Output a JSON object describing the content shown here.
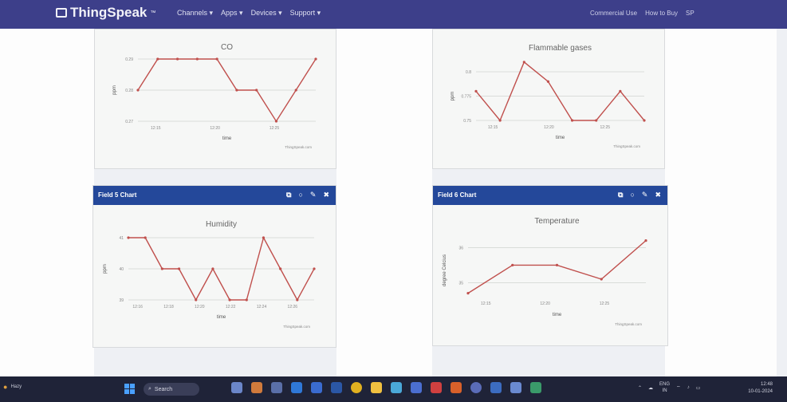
{
  "nav": {
    "brand": "ThingSpeak",
    "brand_mark": "™",
    "links": [
      "Channels ▾",
      "Apps ▾",
      "Devices ▾",
      "Support ▾"
    ],
    "right_links": [
      "Commercial Use",
      "How to Buy",
      "SP"
    ]
  },
  "panels": {
    "field5_header": "Field 5 Chart",
    "field6_header": "Field 6 Chart",
    "header_icons": [
      "external-link-icon",
      "comment-icon",
      "pencil-icon",
      "close-icon"
    ]
  },
  "chart_data": [
    {
      "type": "line",
      "title": "CO",
      "xlabel": "time",
      "ylabel": "ppm",
      "credit": "ThingSpeak.com",
      "x_ticks": [
        "12:15",
        "12:20",
        "12:25"
      ],
      "y_ticks": [
        0.27,
        0.28,
        0.29
      ],
      "ylim": [
        0.27,
        0.29
      ],
      "x": [
        0,
        1,
        2,
        3,
        4,
        5,
        6,
        7,
        8,
        9
      ],
      "values": [
        0.28,
        0.29,
        0.29,
        0.29,
        0.29,
        0.28,
        0.28,
        0.27,
        0.28,
        0.29
      ],
      "color": "#c0504d"
    },
    {
      "type": "line",
      "title": "Flammable gases",
      "xlabel": "time",
      "ylabel": "ppm",
      "credit": "ThingSpeak.com",
      "x_ticks": [
        "12:15",
        "12:20",
        "12:25"
      ],
      "y_ticks": [
        0.75,
        0.775,
        0.8
      ],
      "ylim": [
        0.75,
        0.8
      ],
      "x": [
        0,
        1,
        2,
        3,
        4,
        5,
        6,
        7,
        8,
        9
      ],
      "values": [
        0.78,
        0.75,
        0.81,
        0.79,
        0.75,
        0.75,
        0.78,
        0.75
      ],
      "color": "#c0504d"
    },
    {
      "type": "line",
      "title": "Humidity",
      "xlabel": "time",
      "ylabel": "ppm",
      "credit": "ThingSpeak.com",
      "x_ticks": [
        "12:16",
        "12:18",
        "12:20",
        "12:22",
        "12:24",
        "12:26"
      ],
      "y_ticks": [
        39,
        40,
        41
      ],
      "ylim": [
        39,
        41
      ],
      "values": [
        41,
        41,
        40,
        40,
        39,
        40,
        39,
        39,
        41,
        40,
        39,
        40
      ],
      "color": "#c0504d"
    },
    {
      "type": "line",
      "title": "Temperature",
      "xlabel": "time",
      "ylabel": "degree Celcius",
      "credit": "ThingSpeak.com",
      "x_ticks": [
        "12:15",
        "12:20",
        "12:25"
      ],
      "y_ticks": [
        35,
        36
      ],
      "ylim": [
        34.6,
        36.1
      ],
      "values": [
        34.7,
        35.5,
        35.5,
        35.1,
        36.2
      ],
      "color": "#c0504d"
    }
  ],
  "taskbar": {
    "weather": "Hazy",
    "search_label": "Search",
    "lang": "ENG",
    "region": "IN",
    "time": "12:48",
    "date": "10-01-2024"
  },
  "colors": {
    "nav": "#3d3f8a",
    "panel_header": "#24489a",
    "line": "#c0504d",
    "taskbar": "#1f2338"
  }
}
